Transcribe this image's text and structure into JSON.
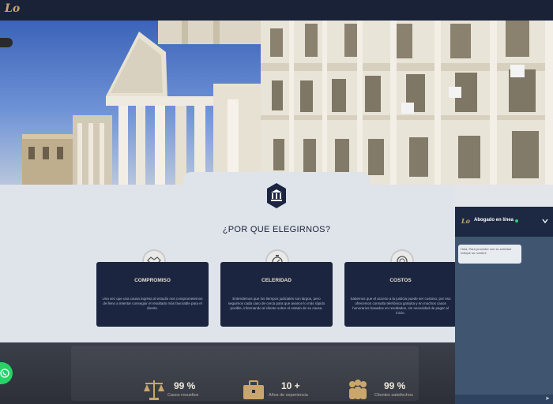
{
  "header": {
    "logo_text": "Lo"
  },
  "why": {
    "title": "¿POR QUE ELEGIRNOS?",
    "cards": [
      {
        "title": "COMPROMISO",
        "icon": "handshake-icon",
        "body": "Una vez que una causa ingresa al estudio nos comprometemos de lleno a intentar conseguir el resultado más favorable para el cliente."
      },
      {
        "title": "CELERIDAD",
        "icon": "stopwatch-icon",
        "body": "Entendemos que los tiempos judiciales son largos, pero seguimos cada caso de cerca para que avance lo más rápido posible, informando al cliente sobre el estado de su causa."
      },
      {
        "title": "COSTOS",
        "icon": "coins-icon",
        "body": "Sabemos que el acceso a la justicia puede ser costoso, por eso ofrecemos consulta telefónica gratuita y en muchos casos honorarios basados en resultados, sin necesidad de pagar al inicio."
      }
    ]
  },
  "stats": [
    {
      "value": "99 %",
      "label": "Casos resueltos",
      "icon": "scales-icon"
    },
    {
      "value": "10 +",
      "label": "Años de experiencia",
      "icon": "briefcase-icon"
    },
    {
      "value": "99 %",
      "label": "Clientes satisfechos",
      "icon": "people-icon"
    }
  ],
  "chat": {
    "name": "Abogado en línea",
    "message": "Hola, Para proceder con su solicitud indique su nombre",
    "status_color": "#2ecc71"
  },
  "colors": {
    "navy": "#1b2540",
    "gold": "#c9a66b",
    "whatsapp": "#25d366"
  }
}
